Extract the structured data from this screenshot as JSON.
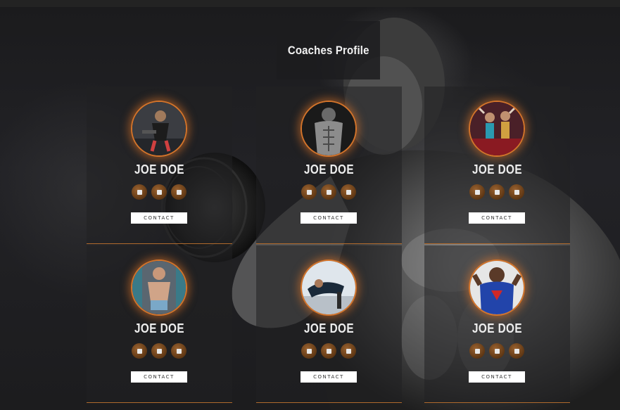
{
  "page": {
    "title": "Coaches Profile"
  },
  "coaches": [
    {
      "name": "JOE DOE",
      "contact_label": "CONTACT"
    },
    {
      "name": "JOE DOE",
      "contact_label": "CONTACT"
    },
    {
      "name": "JOE DOE",
      "contact_label": "CONTACT"
    },
    {
      "name": "JOE DOE",
      "contact_label": "CONTACT"
    },
    {
      "name": "JOE DOE",
      "contact_label": "CONTACT"
    },
    {
      "name": "JOE DOE",
      "contact_label": "CONTACT"
    }
  ],
  "social_icons": [
    "facebook-icon",
    "twitter-icon",
    "instagram-icon"
  ],
  "colors": {
    "accent": "#d4742a",
    "card_bg": "#202022",
    "button_bg": "#ffffff"
  }
}
